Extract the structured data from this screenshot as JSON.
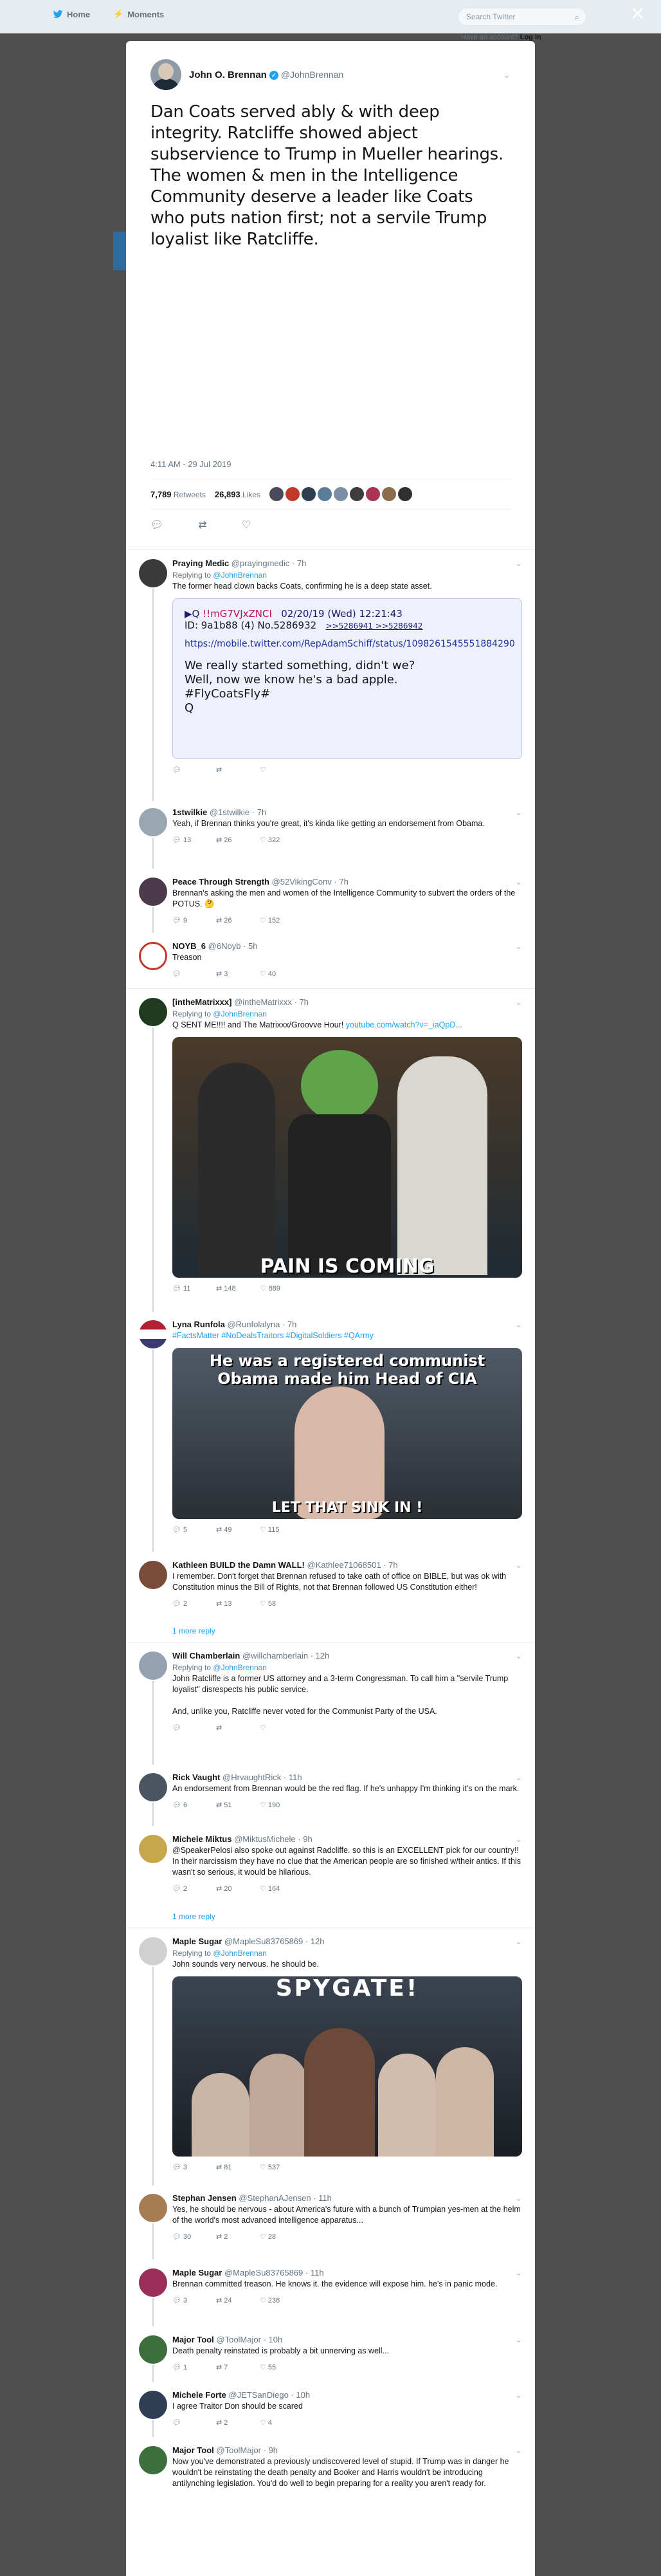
{
  "nav": {
    "home": "Home",
    "moments": "Moments",
    "search_placeholder": "Search Twitter",
    "account_q": "Have an account?",
    "login": "Log in"
  },
  "tweet": {
    "name": "John O. Brennan",
    "handle": "@JohnBrennan",
    "text": "Dan Coats served ably & with deep integrity. Ratcliffe showed abject subservience to Trump in Mueller hearings. The women & men in the Intelligence Community deserve a leader like Coats who puts nation first; not a servile Trump loyalist like Ratcliffe.",
    "date": "4:11 AM - 29 Jul 2019",
    "retweets": "7,789",
    "retweets_label": "Retweets",
    "likes": "26,893",
    "likes_label": "Likes"
  },
  "replies": [
    {
      "name": "Praying Medic",
      "handle": "@prayingmedic",
      "time": "· 7h",
      "replyto": "@JohnBrennan",
      "text": "The former head clown backs Coats, confirming he is a deep state asset.",
      "counts": [
        "",
        "",
        ""
      ]
    },
    {
      "name": "1stwilkie",
      "handle": "@1stwilkie",
      "time": "· 7h",
      "text": "Yeah, if Brennan thinks you're great, it's kinda like getting an endorsement from Obama.",
      "counts": [
        "13",
        "26",
        "322"
      ]
    },
    {
      "name": "Peace Through Strength",
      "handle": "@52VikingConv",
      "time": "· 7h",
      "text": "Brennan's asking the men and women of the Intelligence Community to subvert the orders of the POTUS. 🤔",
      "counts": [
        "9",
        "26",
        "152"
      ]
    },
    {
      "name": "NOYB_6",
      "handle": "@6Noyb",
      "time": "· 5h",
      "text": "Treason",
      "counts": [
        "",
        "3",
        "40"
      ]
    },
    {
      "name": "[intheMatrixxx]",
      "handle": "@intheMatrixxx",
      "time": "· 7h",
      "replyto": "@JohnBrennan",
      "text": "Q SENT ME!!!! and The Matrixxx/Groovve Hour! ",
      "link": "youtube.com/watch?v=_iaQpD...",
      "counts": [
        "11",
        "148",
        "889"
      ]
    },
    {
      "name": "Lyna Runfola",
      "handle": "@Runfolalyna",
      "time": "· 7h",
      "text": "#FactsMatter #NoDealsTraitors #DigitalSoldiers #QArmy",
      "counts": [
        "5",
        "49",
        "115"
      ]
    },
    {
      "name": "Kathleen BUILD the Damn WALL!",
      "handle": "@Kathlee71068501",
      "time": "· 7h",
      "text": "I remember. Don't forget that Brennan refused to take oath of office on BIBLE, but was ok with Constitution minus the Bill of Rights, not that Brennan followed US Constitution either!",
      "counts": [
        "2",
        "13",
        "58"
      ]
    },
    {
      "name": "Will Chamberlain",
      "handle": "@willchamberlain",
      "time": "· 12h",
      "replyto": "@JohnBrennan",
      "text": "John Ratcliffe is a former US attorney and a 3-term Congressman. To call him a \"servile Trump loyalist\" disrespects his public service.\n\nAnd, unlike you, Ratcliffe never voted for the Communist Party of the USA.",
      "counts": [
        "",
        "",
        ""
      ]
    },
    {
      "name": "Rick Vaught",
      "handle": "@HrvaughtRick",
      "time": "· 11h",
      "text": "An endorsement from Brennan would be the red flag. If he's unhappy I'm thinking it's on the mark.",
      "counts": [
        "6",
        "51",
        "190"
      ]
    },
    {
      "name": "Michele Miktus",
      "handle": "@MiktusMichele",
      "time": "· 9h",
      "text": "@SpeakerPelosi also spoke out against Radcliffe. so this is an EXCELLENT pick for our country!! In their narcissism they have no clue that the American people are so finished w/their antics. If this wasn't so serious, it would be hilarious.",
      "counts": [
        "2",
        "20",
        "164"
      ]
    },
    {
      "name": "Maple Sugar",
      "handle": "@MapleSu83765869",
      "time": "· 12h",
      "replyto": "@JohnBrennan",
      "text": "John sounds very nervous. he should be.",
      "counts": [
        "3",
        "81",
        "537"
      ]
    },
    {
      "name": "Stephan Jensen",
      "handle": "@StephanAJensen",
      "time": "· 11h",
      "text": "Yes, he should be nervous - about America's future with a bunch of Trumpian yes-men at the helm of the world's most advanced intelligence apparatus...",
      "counts": [
        "30",
        "2",
        "28"
      ]
    },
    {
      "name": "Maple Sugar",
      "handle": "@MapleSu83765869",
      "time": "· 11h",
      "text": "Brennan committed treason.  He knows it. the evidence will expose him. he's in panic mode.",
      "counts": [
        "3",
        "24",
        "236"
      ]
    },
    {
      "name": "Major Tool",
      "handle": "@ToolMajor",
      "time": "· 10h",
      "text": "Death penalty reinstated is probably a bit unnerving as well...",
      "counts": [
        "1",
        "7",
        "55"
      ]
    },
    {
      "name": "Michele Forte",
      "handle": "@JETSanDiego",
      "time": "· 10h",
      "text": "I agree Traitor Don should be scared",
      "counts": [
        "",
        "2",
        "4"
      ]
    },
    {
      "name": "Major Tool",
      "handle": "@ToolMajor",
      "time": "· 9h",
      "text": "Now you've demonstrated a previously undiscovered level of stupid. If Trump was in danger he wouldn't be reinstating the death penalty and Booker and Harris wouldn't be introducing antilynching legislation. You'd do well to begin preparing for a reality you aren't ready for.",
      "counts": [
        "",
        "",
        ""
      ]
    }
  ],
  "replying_to": "Replying to",
  "more_reply": "1 more reply",
  "qpost": {
    "line1": "▶Q",
    "trip": "!!mG7VJxZNCI",
    "date": "02/20/19 (Wed) 12:21:43",
    "id": "ID: 9a1b88 (4)",
    "num": "No.5286932",
    "refs": ">>5286941 >>5286942",
    "url": "https://mobile.twitter.com/RepAdamSchiff/status/1098261545551884290",
    "body": "We really started something, didn't we?\nWell, now we know he's a bad apple.\n#FlyCoatsFly#\nQ"
  },
  "images": {
    "pepe": "PAIN IS COMING",
    "cia_top": "He was a registered communist Obama made him Head of CIA",
    "cia_bottom": "LET THAT SINK IN !",
    "spygate": "SPYGATE!"
  }
}
